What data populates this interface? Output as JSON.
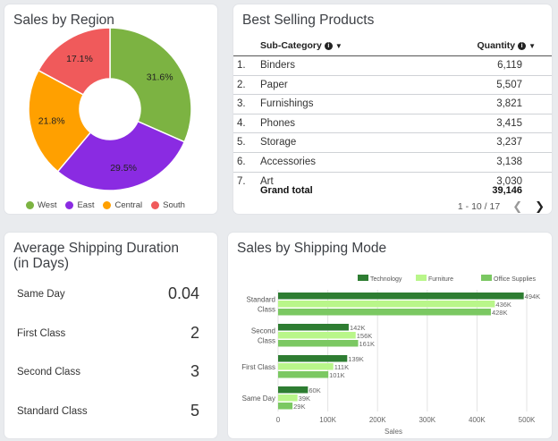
{
  "region_card": {
    "title": "Sales by Region",
    "legend": [
      {
        "label": "West",
        "color": "#7cb342"
      },
      {
        "label": "East",
        "color": "#8a2be2"
      },
      {
        "label": "Central",
        "color": "#ffa000"
      },
      {
        "label": "South",
        "color": "#f05a5b"
      }
    ]
  },
  "products_card": {
    "title": "Best Selling Products",
    "col_subcategory": "Sub-Category",
    "col_quantity": "Quantity",
    "rows": [
      {
        "num": "1.",
        "name": "Binders",
        "qty": "6,119"
      },
      {
        "num": "2.",
        "name": "Paper",
        "qty": "5,507"
      },
      {
        "num": "3.",
        "name": "Furnishings",
        "qty": "3,821"
      },
      {
        "num": "4.",
        "name": "Phones",
        "qty": "3,415"
      },
      {
        "num": "5.",
        "name": "Storage",
        "qty": "3,237"
      },
      {
        "num": "6.",
        "name": "Accessories",
        "qty": "3,138"
      },
      {
        "num": "7.",
        "name": "Art",
        "qty": "3,030"
      }
    ],
    "grand_total_label": "Grand total",
    "grand_total_value": "39,146",
    "pagination": "1 - 10 / 17"
  },
  "shipping_card": {
    "title_line1": "Average Shipping Duration",
    "title_line2": "(in Days)",
    "rows": [
      {
        "label": "Same Day",
        "value": "0.04"
      },
      {
        "label": "First Class",
        "value": "2"
      },
      {
        "label": "Second Class",
        "value": "3"
      },
      {
        "label": "Standard Class",
        "value": "5"
      }
    ]
  },
  "mode_card": {
    "title": "Sales by Shipping Mode"
  },
  "chart_data": [
    {
      "type": "pie",
      "title": "Sales by Region",
      "donut": true,
      "categories": [
        "West",
        "East",
        "Central",
        "South"
      ],
      "values": [
        31.6,
        29.5,
        21.8,
        17.1
      ],
      "labels": [
        "31.6%",
        "29.5%",
        "21.8%",
        "17.1%"
      ],
      "colors": [
        "#7cb342",
        "#8a2be2",
        "#ffa000",
        "#f05a5b"
      ],
      "legend": "bottom"
    },
    {
      "type": "bar",
      "orientation": "horizontal",
      "title": "Sales by Shipping Mode",
      "categories": [
        "Standard Class",
        "Second Class",
        "First Class",
        "Same Day"
      ],
      "category_lines": [
        [
          "Standard",
          "Class"
        ],
        [
          "Second",
          "Class"
        ],
        [
          "First Class"
        ],
        [
          "Same Day"
        ]
      ],
      "series": [
        {
          "name": "Technology",
          "values": [
            494000,
            142000,
            139000,
            60000
          ],
          "labels": [
            "494K",
            "142K",
            "139K",
            "60K"
          ],
          "color": "#2e7d32"
        },
        {
          "name": "Furniture",
          "values": [
            436000,
            156000,
            111000,
            39000
          ],
          "labels": [
            "436K",
            "156K",
            "111K",
            "39K"
          ],
          "color": "#b9f68a"
        },
        {
          "name": "Office Supplies",
          "values": [
            428000,
            161000,
            101000,
            29000
          ],
          "labels": [
            "428K",
            "161K",
            "101K",
            "29K"
          ],
          "color": "#7bc862"
        }
      ],
      "xlabel": "Sales",
      "xlim": [
        0,
        500000
      ],
      "xticks": [
        "0",
        "100K",
        "200K",
        "300K",
        "400K",
        "500K"
      ],
      "legend": "top",
      "grid": true
    }
  ]
}
